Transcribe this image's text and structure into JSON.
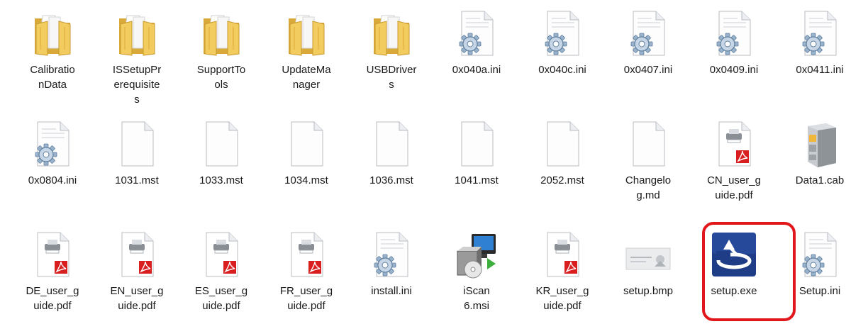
{
  "colors": {
    "highlight": "#e0181b",
    "folder": "#f2cc5f",
    "pdf": "#d81e1e",
    "setup_icon": "#1e3d86"
  },
  "files": [
    {
      "name": "CalibrationData",
      "label_lines": [
        "Calibratio",
        "nData"
      ],
      "icon": "folder-icon"
    },
    {
      "name": "ISSetupPrerequisites",
      "label_lines": [
        "ISSetupPr",
        "erequisite",
        "s"
      ],
      "icon": "folder-icon"
    },
    {
      "name": "SupportTools",
      "label_lines": [
        "SupportTo",
        "ols"
      ],
      "icon": "folder-icon"
    },
    {
      "name": "UpdateManager",
      "label_lines": [
        "UpdateMa",
        "nager"
      ],
      "icon": "folder-icon"
    },
    {
      "name": "USBDrivers",
      "label_lines": [
        "USBDriver",
        "s"
      ],
      "icon": "folder-icon"
    },
    {
      "name": "0x040a.ini",
      "label_lines": [
        "0x040a.ini"
      ],
      "icon": "settings-file-icon"
    },
    {
      "name": "0x040c.ini",
      "label_lines": [
        "0x040c.ini"
      ],
      "icon": "settings-file-icon"
    },
    {
      "name": "0x0407.ini",
      "label_lines": [
        "0x0407.ini"
      ],
      "icon": "settings-file-icon"
    },
    {
      "name": "0x0409.ini",
      "label_lines": [
        "0x0409.ini"
      ],
      "icon": "settings-file-icon"
    },
    {
      "name": "0x0411.ini",
      "label_lines": [
        "0x0411.ini"
      ],
      "icon": "settings-file-icon"
    },
    {
      "name": "0x0804.ini",
      "label_lines": [
        "0x0804.ini"
      ],
      "icon": "settings-file-icon"
    },
    {
      "name": "1031.mst",
      "label_lines": [
        "1031.mst"
      ],
      "icon": "blank-file-icon"
    },
    {
      "name": "1033.mst",
      "label_lines": [
        "1033.mst"
      ],
      "icon": "blank-file-icon"
    },
    {
      "name": "1034.mst",
      "label_lines": [
        "1034.mst"
      ],
      "icon": "blank-file-icon"
    },
    {
      "name": "1036.mst",
      "label_lines": [
        "1036.mst"
      ],
      "icon": "blank-file-icon"
    },
    {
      "name": "1041.mst",
      "label_lines": [
        "1041.mst"
      ],
      "icon": "blank-file-icon"
    },
    {
      "name": "2052.mst",
      "label_lines": [
        "2052.mst"
      ],
      "icon": "blank-file-icon"
    },
    {
      "name": "Changelog.md",
      "label_lines": [
        "Changelo",
        "g.md"
      ],
      "icon": "blank-file-icon"
    },
    {
      "name": "CN_user_guide.pdf",
      "label_lines": [
        "CN_user_g",
        "uide.pdf"
      ],
      "icon": "pdf-file-icon"
    },
    {
      "name": "Data1.cab",
      "label_lines": [
        "Data1.cab"
      ],
      "icon": "cabinet-icon"
    },
    {
      "name": "DE_user_guide.pdf",
      "label_lines": [
        "DE_user_g",
        "uide.pdf"
      ],
      "icon": "pdf-file-icon"
    },
    {
      "name": "EN_user_guide.pdf",
      "label_lines": [
        "EN_user_g",
        "uide.pdf"
      ],
      "icon": "pdf-file-icon"
    },
    {
      "name": "ES_user_guide.pdf",
      "label_lines": [
        "ES_user_g",
        "uide.pdf"
      ],
      "icon": "pdf-file-icon"
    },
    {
      "name": "FR_user_guide.pdf",
      "label_lines": [
        "FR_user_g",
        "uide.pdf"
      ],
      "icon": "pdf-file-icon"
    },
    {
      "name": "install.ini",
      "label_lines": [
        "install.ini"
      ],
      "icon": "settings-file-icon"
    },
    {
      "name": "iScan6.msi",
      "label_lines": [
        "iScan",
        "6.msi"
      ],
      "icon": "installer-icon"
    },
    {
      "name": "KR_user_guide.pdf",
      "label_lines": [
        "KR_user_g",
        "uide.pdf"
      ],
      "icon": "pdf-file-icon"
    },
    {
      "name": "setup.bmp",
      "label_lines": [
        "setup.bmp"
      ],
      "icon": "image-thumbnail-icon"
    },
    {
      "name": "setup.exe",
      "label_lines": [
        "setup.exe"
      ],
      "icon": "setup-exe-icon",
      "highlighted": true
    },
    {
      "name": "Setup.ini",
      "label_lines": [
        "Setup.ini"
      ],
      "icon": "settings-file-icon"
    }
  ]
}
